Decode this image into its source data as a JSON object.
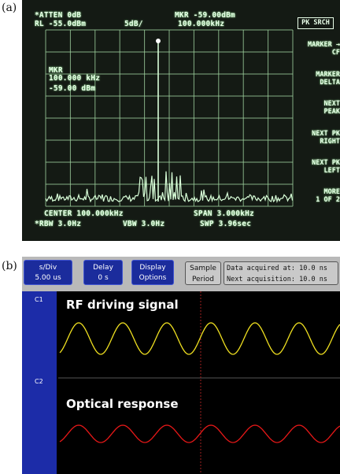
{
  "panel_a": {
    "label": "(a)",
    "header": {
      "atten": "*ATTEN 0dB",
      "rl": "RL  -55.0dBm",
      "scale": "5dB/",
      "mkr_amp": "MKR -59.00dBm",
      "mkr_freq": "100.000kHz"
    },
    "marker_box": {
      "title": "MKR",
      "freq": "100.000 kHz",
      "amp": "-59.00 dBm"
    },
    "footer": {
      "center": "CENTER 100.000kHz",
      "span": "SPAN 3.000kHz",
      "rbw": "*RBW 3.0Hz",
      "vbw": "VBW 3.0Hz",
      "swp": "SWP 3.96sec"
    },
    "softkeys": {
      "active": "PK SRCH",
      "items": [
        {
          "line1": "MARKER →",
          "line2": "CF"
        },
        {
          "line1": "MARKER",
          "line2": "DELTA"
        },
        {
          "line1": "NEXT",
          "line2": "PEAK"
        },
        {
          "line1": "NEXT PK",
          "line2": "RIGHT"
        },
        {
          "line1": "NEXT PK",
          "line2": "LEFT"
        },
        {
          "line1": "MORE",
          "line2": "1 OF 2"
        }
      ]
    },
    "trace_color": "#d9ffd9",
    "grid_color": "#9fd39f"
  },
  "panel_b": {
    "label": "(b)",
    "toolbar": {
      "time_div_label": "s/Div",
      "time_div_value": "5.00 us",
      "delay_label": "Delay",
      "delay_value": "0   s",
      "display_label": "Display",
      "display_value": "Options",
      "sample_line1": "Sample",
      "sample_line2": "Period",
      "acq_line1": "Data acquired at: 10.0 ns",
      "acq_line2": "Next acquisition: 10.0 ns"
    },
    "channels": [
      {
        "id": "C1",
        "title": "RF driving signal",
        "color": "#f0e020"
      },
      {
        "id": "C2",
        "title": "Optical response",
        "color": "#e81818"
      }
    ],
    "button_color": "#1b2c9c"
  }
}
